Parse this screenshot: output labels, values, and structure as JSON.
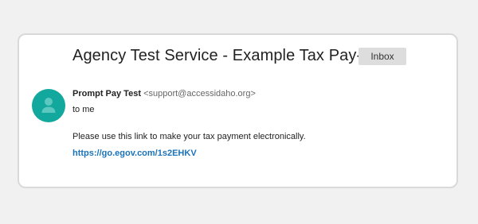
{
  "email": {
    "subject": "Agency Test Service - Example Tax Pay-",
    "folder_badge": "Inbox",
    "sender": {
      "name": "Prompt Pay Test",
      "email": "<support@accessidaho.org>",
      "avatar_icon": "person-icon"
    },
    "recipient": "to me",
    "body": "Please use this link to make your tax payment electronically.",
    "link": "https://go.egov.com/1s2EHKV"
  },
  "colors": {
    "background": "#f1f1f1",
    "avatar": "#12a89d",
    "link": "#1a73b8",
    "badge": "#dddddd"
  }
}
